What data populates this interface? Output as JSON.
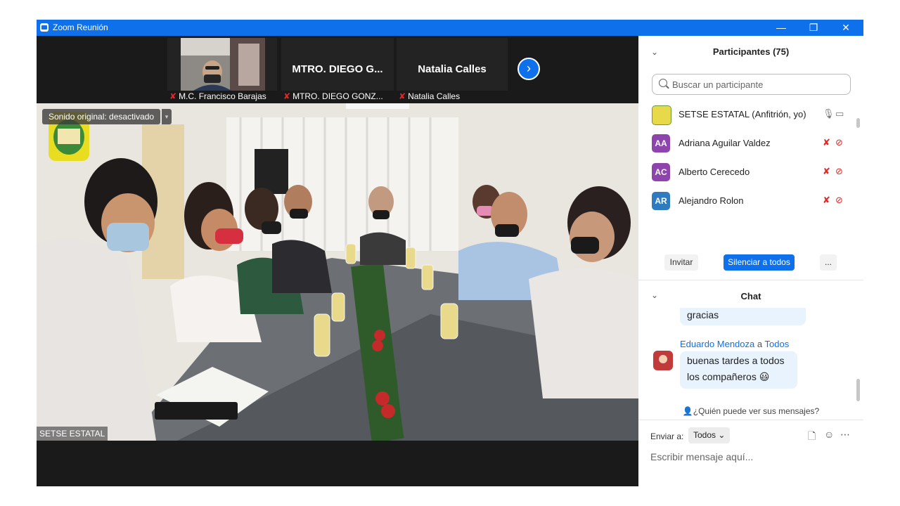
{
  "window": {
    "title": "Zoom Reunión",
    "controls": {
      "minimize": "—",
      "restore": "❐",
      "close": "✕"
    }
  },
  "thumbnails": [
    {
      "name": "M.C. Francisco Barajas",
      "has_video": true
    },
    {
      "name": "MTRO. DIEGO GONZ...",
      "display": "MTRO. DIEGO G...",
      "has_video": false
    },
    {
      "name": "Natalia Calles",
      "display": "Natalia Calles",
      "has_video": false
    }
  ],
  "strip": {
    "next_icon": "›"
  },
  "main_video": {
    "audio_setting": "Sonido original: desactivado",
    "speaker_name": "SETSE ESTATAL"
  },
  "participants": {
    "title": "Participantes (75)",
    "search_placeholder": "Buscar un participante",
    "list": [
      {
        "initials": "",
        "name": "SETSE ESTATAL (Anfitrión, yo)",
        "avatar_color": "#4a8a3a",
        "muted": false
      },
      {
        "initials": "AA",
        "name": "Adriana Aguilar Valdez",
        "avatar_color": "#8e44ad",
        "muted": true
      },
      {
        "initials": "AC",
        "name": "Alberto Cerecedo",
        "avatar_color": "#8e44ad",
        "muted": true
      },
      {
        "initials": "AR",
        "name": "Alejandro Rolon",
        "avatar_color": "#2e7bbf",
        "muted": true
      }
    ],
    "buttons": {
      "invite": "Invitar",
      "mute_all": "Silenciar a todos",
      "more": "..."
    }
  },
  "chat": {
    "title": "Chat",
    "messages": [
      {
        "text": "gracias"
      },
      {
        "sender": "Eduardo Mendoza",
        "connector": "a",
        "recipient": "Todos",
        "line1": "buenas tardes a todos",
        "line2": "los compañeros",
        "emoji": "😃"
      }
    ],
    "who_can_see": "¿Quién puede ver sus mensajes?",
    "send_to_label": "Enviar a:",
    "send_to_value": "Todos",
    "input_placeholder": "Escribir mensaje aquí..."
  },
  "colors": {
    "zoom_blue": "#0e71eb",
    "muted_red": "#e02828"
  }
}
